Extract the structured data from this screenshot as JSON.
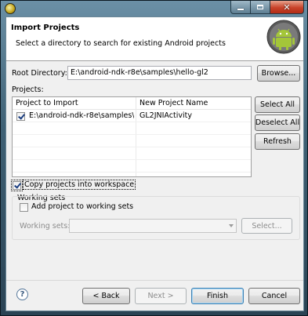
{
  "window": {
    "title": ""
  },
  "header": {
    "title": "Import Projects",
    "description": "Select a directory to search for existing Android projects"
  },
  "root_directory": {
    "label": "Root Directory:",
    "value": "E:\\android-ndk-r8e\\samples\\hello-gl2",
    "browse_label": "Browse..."
  },
  "projects": {
    "label": "Projects:",
    "columns": [
      "Project to Import",
      "New Project Name"
    ],
    "rows": [
      {
        "checked": true,
        "project": "E:\\android-ndk-r8e\\samples\\...",
        "new_name": "GL2JNIActivity"
      }
    ]
  },
  "side_buttons": {
    "select_all": "Select All",
    "deselect_all": "Deselect All",
    "refresh": "Refresh"
  },
  "copy_into_workspace": {
    "label": "Copy projects into workspace",
    "checked": true
  },
  "working_sets": {
    "title": "Working sets",
    "add_label": "Add project to working sets",
    "add_checked": false,
    "sets_label": "Working sets:",
    "sets_value": "",
    "select_label": "Select..."
  },
  "footer": {
    "help": "?",
    "back": "< Back",
    "next": "Next >",
    "finish": "Finish",
    "cancel": "Cancel"
  },
  "colors": {
    "frame": "#3f6175",
    "close_button": "#c8432a",
    "android_green": "#a4c639"
  }
}
